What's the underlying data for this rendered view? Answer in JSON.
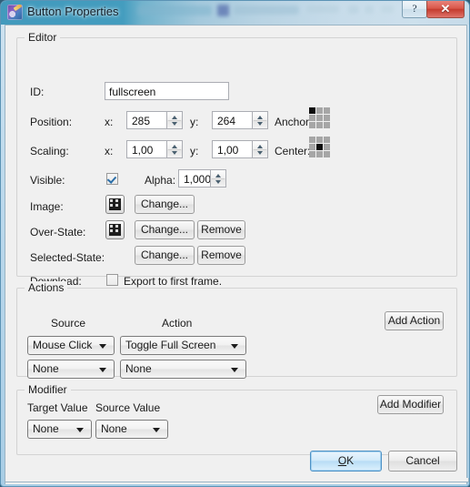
{
  "window": {
    "title": "Button Properties",
    "app_icon": "paint-palette-icon",
    "help_button": "?",
    "close_button": "✕"
  },
  "editor": {
    "group_title": "Editor",
    "id_label": "ID:",
    "id_value": "fullscreen",
    "position_label": "Position:",
    "position_x_label": "x:",
    "position_x_value": "285",
    "position_y_label": "y:",
    "position_y_value": "264",
    "anchor_label": "Anchor:",
    "anchor_selected": "top-left",
    "scaling_label": "Scaling:",
    "scaling_x_label": "x:",
    "scaling_x_value": "1,00",
    "scaling_y_label": "y:",
    "scaling_y_value": "1,00",
    "center_label": "Center:",
    "center_selected": "middle-center",
    "visible_label": "Visible:",
    "visible_checked": true,
    "alpha_label": "Alpha:",
    "alpha_value": "1,000",
    "image_label": "Image:",
    "image_change": "Change...",
    "over_state_label": "Over-State:",
    "over_state_change": "Change...",
    "over_state_remove": "Remove",
    "selected_state_label": "Selected-State:",
    "selected_state_change": "Change...",
    "selected_state_remove": "Remove",
    "download_label": "Download:",
    "export_checkbox_label": "Export to first frame.",
    "export_checked": false
  },
  "actions": {
    "group_title": "Actions",
    "source_header": "Source",
    "action_header": "Action",
    "add_action_button": "Add Action",
    "rows": [
      {
        "source": "Mouse Click",
        "action": "Toggle Full Screen"
      },
      {
        "source": "None",
        "action": "None"
      }
    ]
  },
  "modifier": {
    "group_title": "Modifier",
    "target_value_header": "Target Value",
    "source_value_header": "Source Value",
    "add_modifier_button": "Add Modifier",
    "rows": [
      {
        "target": "None",
        "source": "None"
      }
    ]
  },
  "footer": {
    "ok_button": "OK",
    "ok_accel": "O",
    "ok_rest": "K",
    "cancel_button": "Cancel"
  },
  "colors": {
    "dialog_bg": "#f0f0f0",
    "frame": "#5b93b5",
    "accent_default_button": "#4e92c6",
    "close_button": "#c43c2f",
    "anchor_selected": "#0d0d0d",
    "anchor_cell": "#a6a6a6"
  }
}
